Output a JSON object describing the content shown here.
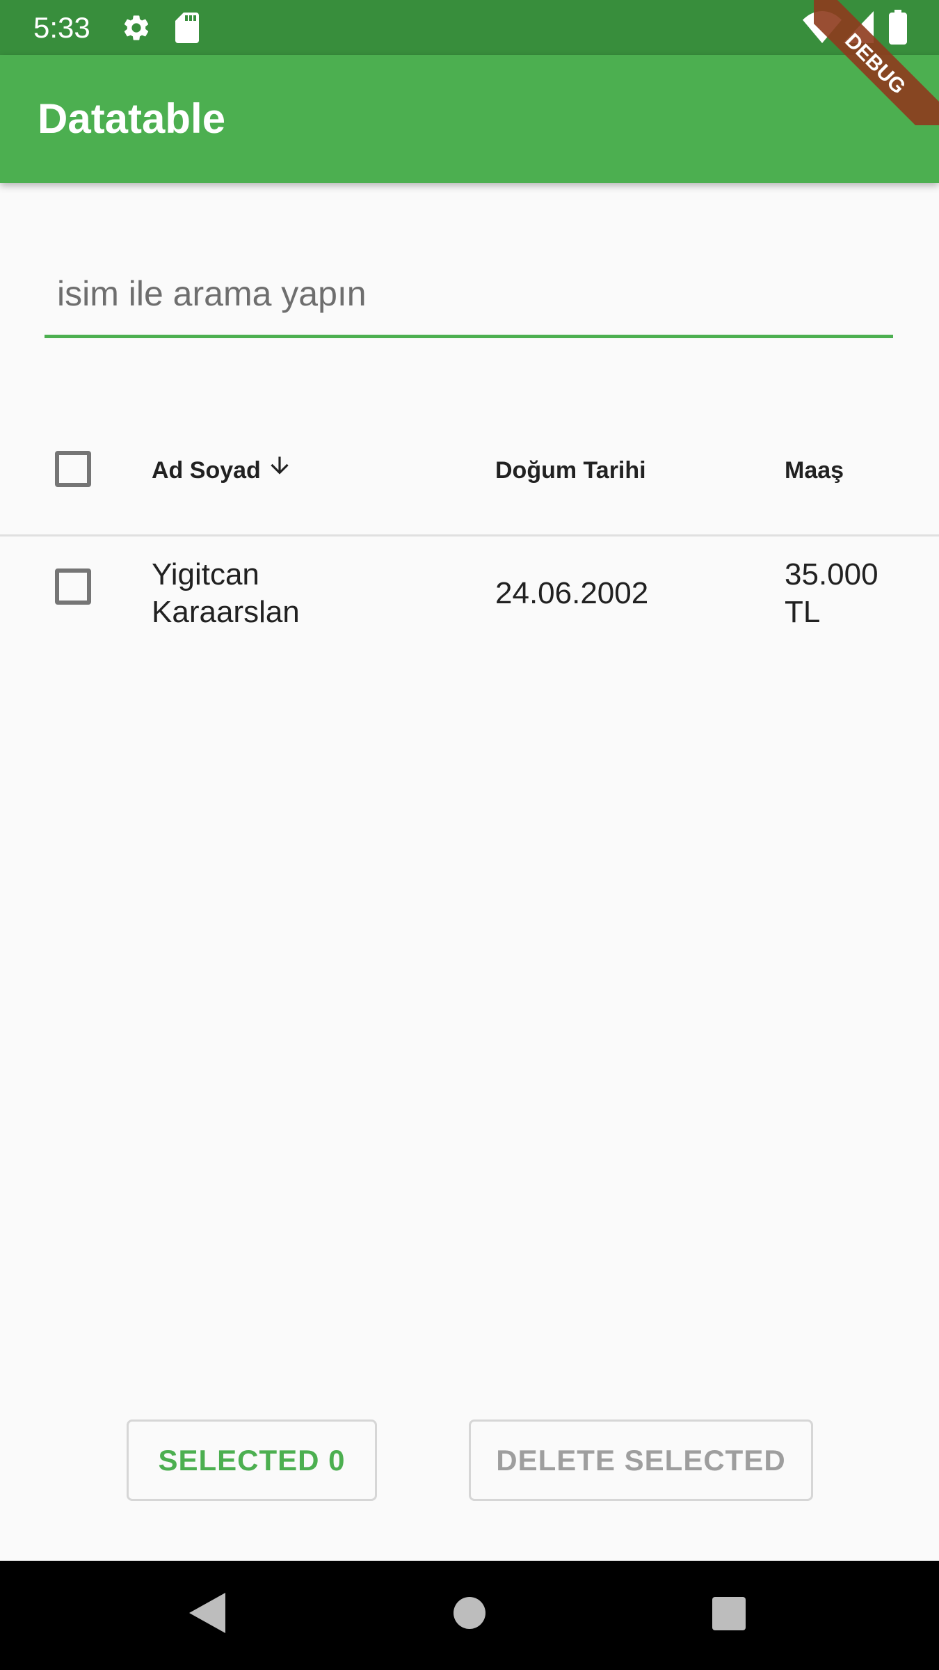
{
  "status_bar": {
    "time": "5:33",
    "icons": [
      "settings-icon",
      "sd-card-icon",
      "wifi-icon",
      "signal-icon",
      "battery-icon"
    ]
  },
  "debug_banner": {
    "label": "DEBUG",
    "color": "#8e3b1d"
  },
  "app_bar": {
    "title": "Datatable",
    "color": "#4caf50"
  },
  "search": {
    "placeholder": "isim ile arama yapın",
    "value": ""
  },
  "table": {
    "columns": [
      {
        "label": "Ad Soyad",
        "sort": "descending",
        "sort_icon": "arrow-down-icon"
      },
      {
        "label": "Doğum Tarihi"
      },
      {
        "label": "Maaş"
      }
    ],
    "rows": [
      {
        "name_line1": "Yigitcan",
        "name_line2": "Karaarslan",
        "birth_date": "24.06.2002",
        "salary_line1": "35.000",
        "salary_line2": "TL",
        "checked": false
      }
    ]
  },
  "buttons": {
    "selected": "SELECTED 0",
    "delete": "DELETE SELECTED"
  },
  "nav_bar": {
    "icons": [
      "back-icon",
      "home-icon",
      "recents-icon"
    ]
  },
  "colors": {
    "accent": "#4caf50",
    "status_bar": "#388e3c",
    "background": "#fafafa"
  }
}
